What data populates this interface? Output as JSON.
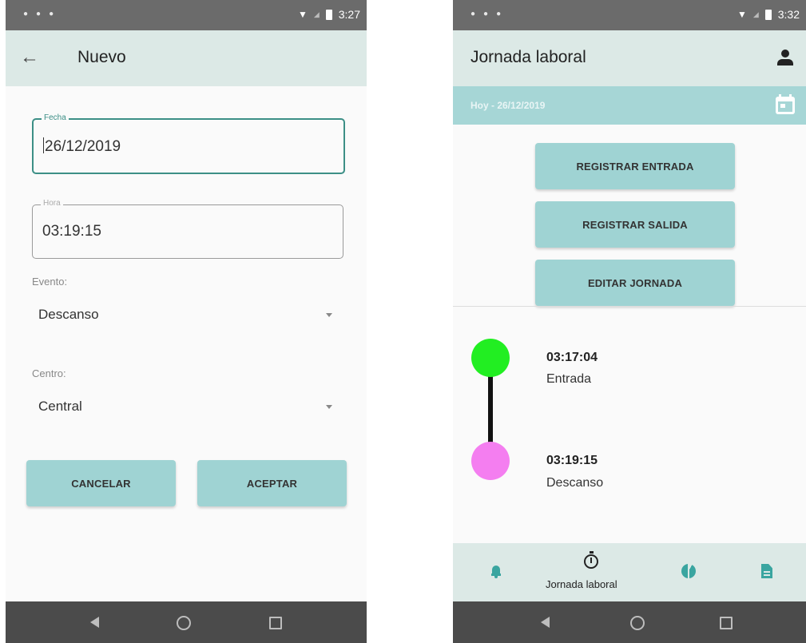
{
  "left": {
    "status_time": "3:27",
    "title": "Nuevo",
    "fecha": {
      "label": "Fecha",
      "value": "26/12/2019"
    },
    "hora": {
      "label": "Hora",
      "value": "03:19:15"
    },
    "evento": {
      "label": "Evento:",
      "value": "Descanso"
    },
    "centro": {
      "label": "Centro:",
      "value": "Central"
    },
    "cancel_label": "CANCELAR",
    "accept_label": "ACEPTAR"
  },
  "right": {
    "status_time": "3:32",
    "title": "Jornada laboral",
    "date_text": "Hoy - 26/12/2019",
    "buttons": [
      "REGISTRAR ENTRADA",
      "REGISTRAR SALIDA",
      "EDITAR JORNADA"
    ],
    "events": [
      {
        "time": "03:17:04",
        "name": "Entrada",
        "color": "#22ee22"
      },
      {
        "time": "03:19:15",
        "name": "Descanso",
        "color": "#f47ef0"
      }
    ],
    "bottom_nav": {
      "items": [
        "bell-icon",
        "timer-icon",
        "pie-chart-icon",
        "document-icon"
      ],
      "active_label": "Jornada laboral"
    }
  },
  "colors": {
    "accent": "#9fd3d3",
    "appbar": "#dce9e6",
    "focus": "#3c8f86",
    "icon": "#3aa5a0"
  }
}
